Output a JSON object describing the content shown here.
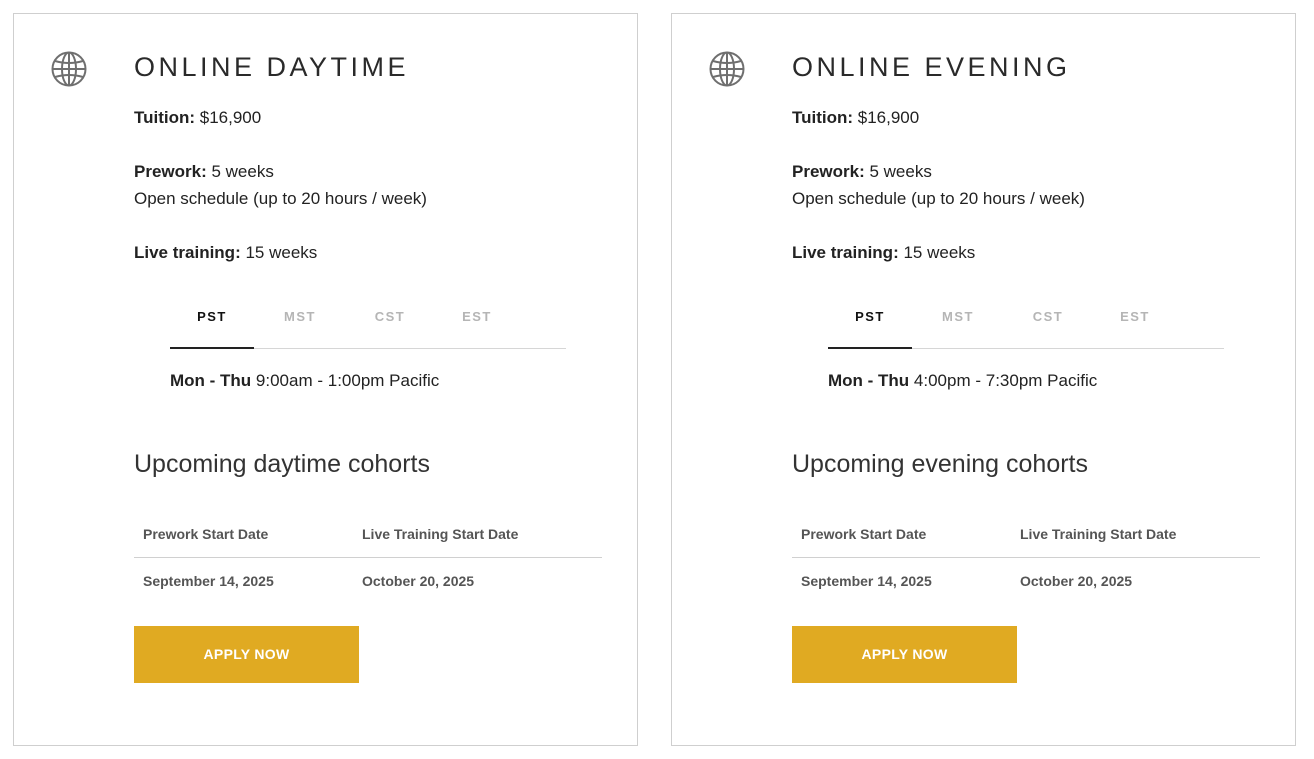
{
  "cards": [
    {
      "title": "ONLINE DAYTIME",
      "tuition_label": "Tuition:",
      "tuition_value": " $16,900",
      "prework_label": "Prework:",
      "prework_value": " 5 weeks",
      "prework_schedule": "Open schedule (up to 20 hours / week)",
      "live_label": "Live training:",
      "live_value": " 15 weeks",
      "timezones": [
        "PST",
        "MST",
        "CST",
        "EST"
      ],
      "active_timezone": "PST",
      "schedule_days": "Mon - Thu",
      "schedule_time": " 9:00am - 1:00pm Pacific",
      "cohorts_heading": "Upcoming daytime cohorts",
      "table_headers": [
        "Prework Start Date",
        "Live Training Start Date"
      ],
      "table_rows": [
        [
          "September 14, 2025",
          "October 20, 2025"
        ]
      ],
      "apply_label": "APPLY NOW",
      "icon": "globe-icon"
    },
    {
      "title": "ONLINE EVENING",
      "tuition_label": "Tuition:",
      "tuition_value": " $16,900",
      "prework_label": "Prework:",
      "prework_value": " 5 weeks",
      "prework_schedule": "Open schedule (up to 20 hours / week)",
      "live_label": "Live training:",
      "live_value": " 15 weeks",
      "timezones": [
        "PST",
        "MST",
        "CST",
        "EST"
      ],
      "active_timezone": "PST",
      "schedule_days": "Mon - Thu",
      "schedule_time": " 4:00pm - 7:30pm Pacific",
      "cohorts_heading": "Upcoming evening cohorts",
      "table_headers": [
        "Prework Start Date",
        "Live Training Start Date"
      ],
      "table_rows": [
        [
          "September 14, 2025",
          "October 20, 2025"
        ]
      ],
      "apply_label": "APPLY NOW",
      "icon": "globe-icon"
    }
  ],
  "colors": {
    "accent": "#e0aa22",
    "border": "#cfcfcf",
    "text": "#222222",
    "muted_tab": "#b5b5b5"
  }
}
